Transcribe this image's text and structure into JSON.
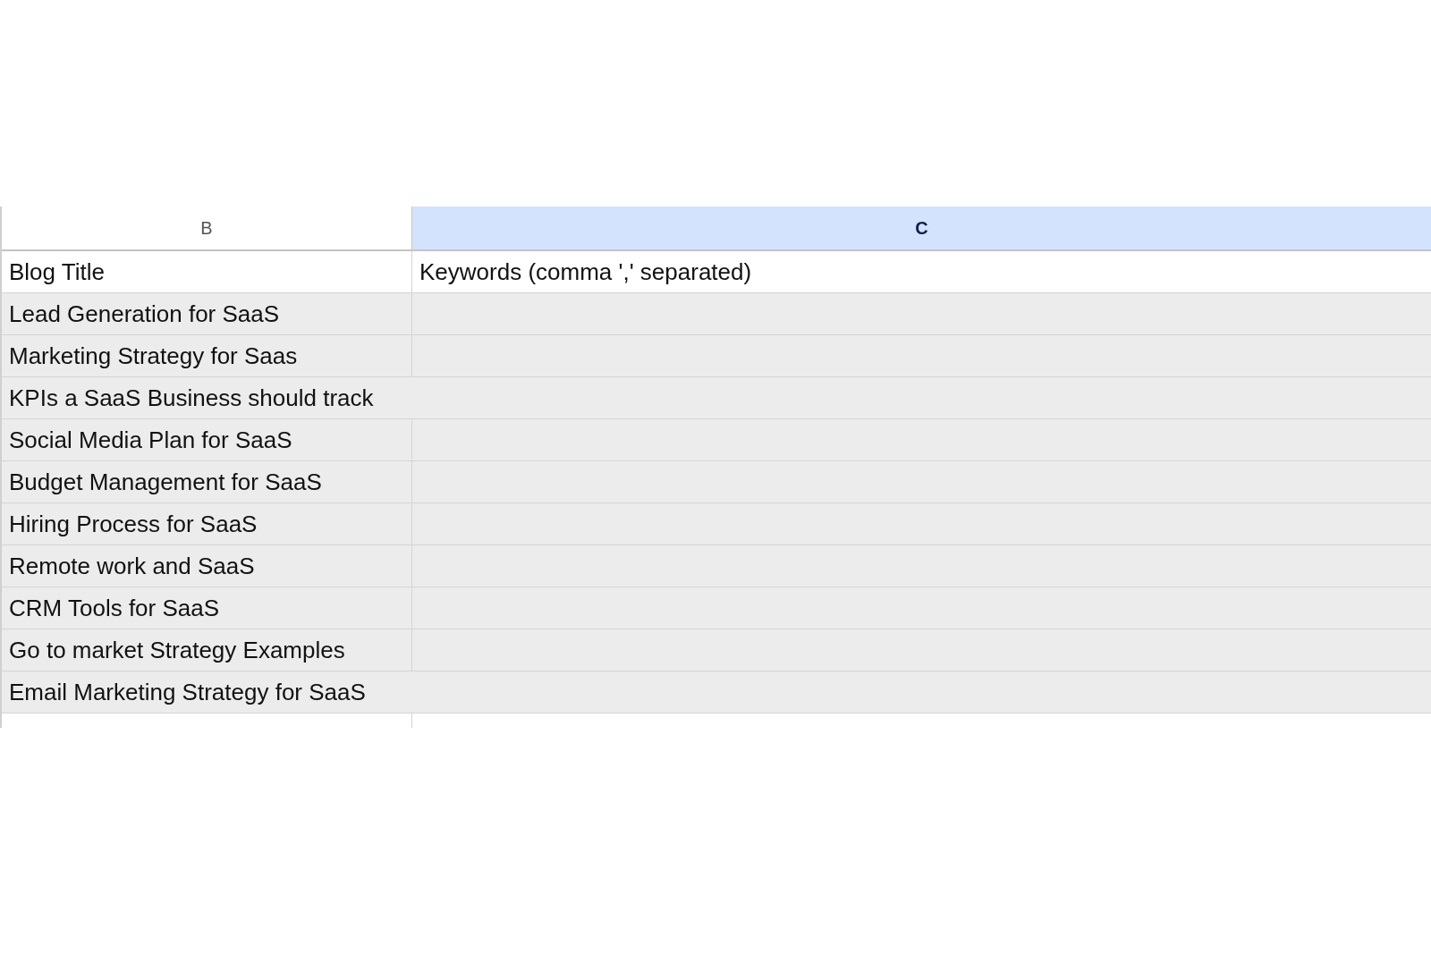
{
  "columns": [
    {
      "label": "B",
      "selected": false
    },
    {
      "label": "C",
      "selected": true
    }
  ],
  "rows": [
    {
      "cells": [
        "Blog Title",
        "Keywords (comma ',' separated)"
      ],
      "shaded": false,
      "spills": false
    },
    {
      "cells": [
        "Lead Generation for SaaS"
      ],
      "shaded": true,
      "spills": false
    },
    {
      "cells": [
        "Marketing Strategy for Saas"
      ],
      "shaded": true,
      "spills": false
    },
    {
      "cells": [
        "KPIs a SaaS Business should track"
      ],
      "shaded": true,
      "spills": true
    },
    {
      "cells": [
        "Social Media Plan for SaaS"
      ],
      "shaded": true,
      "spills": false
    },
    {
      "cells": [
        "Budget Management for SaaS"
      ],
      "shaded": true,
      "spills": false
    },
    {
      "cells": [
        "Hiring Process for SaaS"
      ],
      "shaded": true,
      "spills": false
    },
    {
      "cells": [
        "Remote work and SaaS"
      ],
      "shaded": true,
      "spills": false
    },
    {
      "cells": [
        "CRM Tools for SaaS"
      ],
      "shaded": true,
      "spills": false
    },
    {
      "cells": [
        "Go to market Strategy Examples"
      ],
      "shaded": true,
      "spills": false
    },
    {
      "cells": [
        "Email Marketing Strategy for SaaS"
      ],
      "shaded": true,
      "spills": true
    }
  ]
}
